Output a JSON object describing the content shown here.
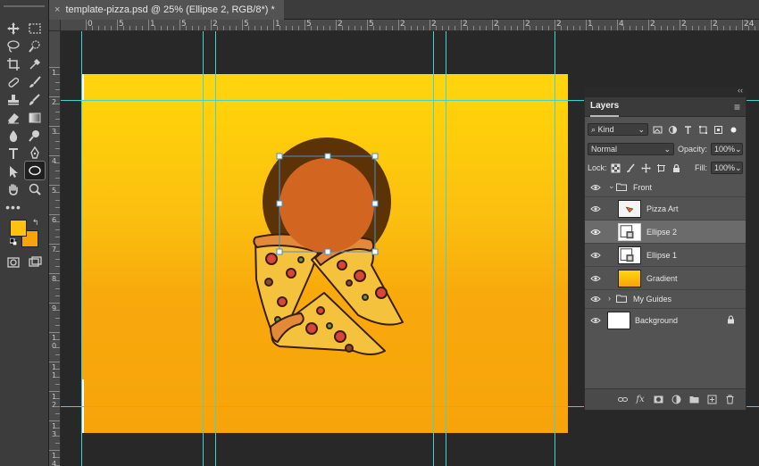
{
  "document_tab": {
    "title": "template-pizza.psd @ 25% (Ellipse 2, RGB/8*) *",
    "close_glyph": "×"
  },
  "ruler_top_labels": [
    "0",
    "5",
    "1",
    "5",
    "2",
    "5",
    "1",
    "5",
    "2",
    "5",
    "2",
    "2",
    "2",
    "2",
    "2",
    "2",
    "1",
    "4",
    "2",
    "2",
    "2",
    "24",
    "26"
  ],
  "ruler_left_labels": [
    "1",
    "2",
    "3",
    "4",
    "5",
    "6",
    "7",
    "8",
    "9",
    "1 0",
    "1 1",
    "1 2",
    "1 3",
    "1 4"
  ],
  "toolbar": {
    "tools": [
      "move-tool",
      "marquee-tool",
      "lasso-tool",
      "quick-select-tool",
      "crop-tool",
      "eyedropper-tool",
      "healing-tool",
      "brush-tool",
      "clone-stamp-tool",
      "history-brush-tool",
      "eraser-tool",
      "gradient-tool",
      "blur-tool",
      "dodge-tool",
      "pen-tool",
      "type-tool",
      "path-select-tool",
      "ellipse-tool",
      "hand-tool",
      "zoom-tool"
    ],
    "active_tool": "ellipse-tool",
    "more_glyph": "•••",
    "foreground_color": "#FFC20E",
    "background_color": "#F7A30A"
  },
  "canvas": {
    "gradient_top": "#FFD50F",
    "gradient_bottom": "#F7A40A",
    "ellipse_1_color": "#5C3306",
    "ellipse_2_color": "#D26520",
    "guide_color": "#3ED4D4"
  },
  "layers_panel": {
    "title": "Layers",
    "collapse_glyph": "‹‹",
    "menu_glyph": "≡",
    "filter_kind": "Kind",
    "blend_mode": "Normal",
    "opacity_label": "Opacity:",
    "opacity_value": "100%",
    "lock_label": "Lock:",
    "fill_label": "Fill:",
    "fill_value": "100%",
    "layers": [
      {
        "name": "Front",
        "type": "group",
        "expanded": true,
        "visible": true,
        "selected": false
      },
      {
        "name": "Pizza Art",
        "type": "layer",
        "indent": true,
        "visible": true,
        "selected": false
      },
      {
        "name": "Ellipse 2",
        "type": "shape",
        "indent": true,
        "visible": true,
        "selected": true
      },
      {
        "name": "Ellipse 1",
        "type": "shape",
        "indent": true,
        "visible": true,
        "selected": false
      },
      {
        "name": "Gradient",
        "type": "fill",
        "indent": true,
        "visible": true,
        "selected": false
      },
      {
        "name": "My Guides",
        "type": "group",
        "expanded": false,
        "visible": true,
        "selected": false
      },
      {
        "name": "Background",
        "type": "background",
        "visible": true,
        "selected": false,
        "locked": true
      }
    ],
    "bottom_icons": [
      "link-layers-icon",
      "fx-icon",
      "mask-icon",
      "adjustment-icon",
      "new-group-icon",
      "new-layer-icon",
      "trash-icon"
    ],
    "fx_text": "fx"
  }
}
